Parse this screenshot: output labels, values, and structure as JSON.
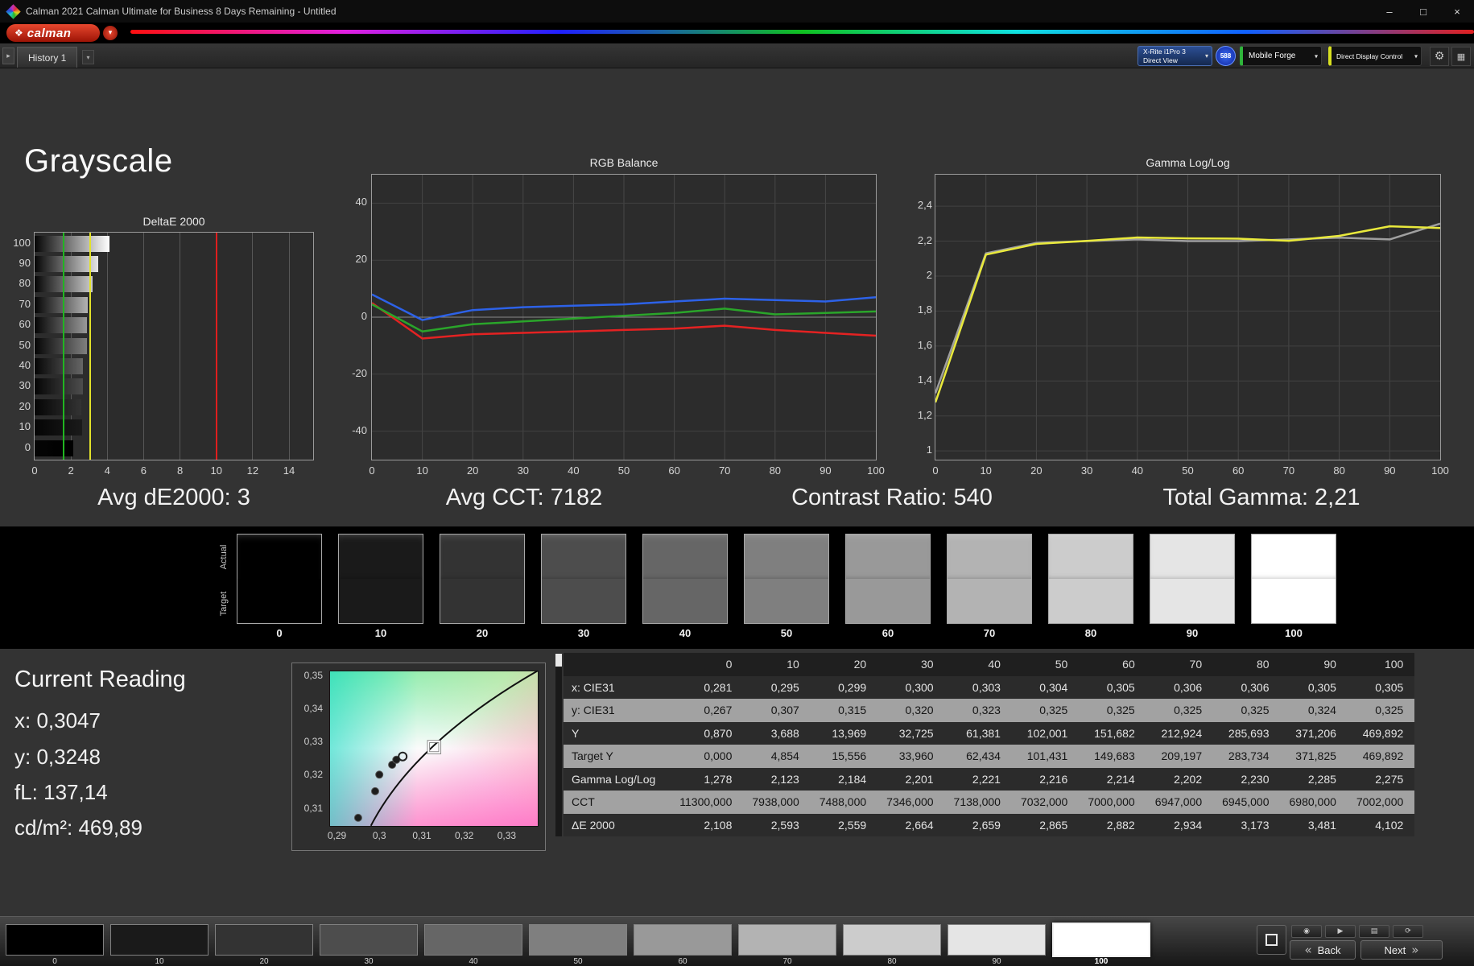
{
  "window": {
    "title": "Calman 2021 Calman Ultimate for Business 8 Days Remaining - Untitled",
    "minimize": "–",
    "maximize": "□",
    "close": "×"
  },
  "toolbar": {
    "logo_mark": "❖",
    "logo": "calman",
    "caret": "▾"
  },
  "tabbar": {
    "toggle": "▸",
    "history_tab": "History 1",
    "tab_menu": "▾",
    "xrite_line1": "X-Rite i1Pro 3",
    "xrite_line2": "Direct View",
    "meter_badge": "588",
    "mobile_forge": "Mobile Forge",
    "display_control": "Direct Display Control",
    "gear": "⚙",
    "layout": "▦"
  },
  "page": {
    "title": "Grayscale",
    "stat_de": "Avg dE2000: 3",
    "stat_cct": "Avg CCT: 7182",
    "stat_contrast": "Contrast Ratio: 540",
    "stat_gamma": "Total Gamma: 2,21"
  },
  "strip": {
    "actual_label": "Actual",
    "target_label": "Target",
    "levels": [
      0,
      10,
      20,
      30,
      40,
      50,
      60,
      70,
      80,
      90,
      100
    ]
  },
  "current_reading": {
    "title": "Current Reading",
    "x": "x: 0,3047",
    "y": "y: 0,3248",
    "fl": "fL: 137,14",
    "cd": "cd/m²: 469,89"
  },
  "table": {
    "columns": [
      "",
      "0",
      "10",
      "20",
      "30",
      "40",
      "50",
      "60",
      "70",
      "80",
      "90",
      "100"
    ],
    "rows": [
      {
        "label": "x: CIE31",
        "values": [
          "0,281",
          "0,295",
          "0,299",
          "0,300",
          "0,303",
          "0,304",
          "0,305",
          "0,306",
          "0,306",
          "0,305",
          "0,305"
        ]
      },
      {
        "label": "y: CIE31",
        "values": [
          "0,267",
          "0,307",
          "0,315",
          "0,320",
          "0,323",
          "0,325",
          "0,325",
          "0,325",
          "0,325",
          "0,324",
          "0,325"
        ]
      },
      {
        "label": "Y",
        "values": [
          "0,870",
          "3,688",
          "13,969",
          "32,725",
          "61,381",
          "102,001",
          "151,682",
          "212,924",
          "285,693",
          "371,206",
          "469,892"
        ]
      },
      {
        "label": "Target Y",
        "values": [
          "0,000",
          "4,854",
          "15,556",
          "33,960",
          "62,434",
          "101,431",
          "149,683",
          "209,197",
          "283,734",
          "371,825",
          "469,892"
        ]
      },
      {
        "label": "Gamma Log/Log",
        "values": [
          "1,278",
          "2,123",
          "2,184",
          "2,201",
          "2,221",
          "2,216",
          "2,214",
          "2,202",
          "2,230",
          "2,285",
          "2,275"
        ]
      },
      {
        "label": "CCT",
        "values": [
          "11300,000",
          "7938,000",
          "7488,000",
          "7346,000",
          "7138,000",
          "7032,000",
          "7000,000",
          "6947,000",
          "6945,000",
          "6980,000",
          "7002,000"
        ]
      },
      {
        "label": "ΔE 2000",
        "values": [
          "2,108",
          "2,593",
          "2,559",
          "2,664",
          "2,659",
          "2,865",
          "2,882",
          "2,934",
          "3,173",
          "3,481",
          "4,102"
        ]
      }
    ]
  },
  "bottom": {
    "levels": [
      0,
      10,
      20,
      30,
      40,
      50,
      60,
      70,
      80,
      90,
      100
    ],
    "selected": 100,
    "back": "Back",
    "next": "Next",
    "back_chevron": "«",
    "next_chevron": "»",
    "tool_icons": [
      "◉",
      "▶",
      "▤",
      "⟳"
    ]
  },
  "chart_data": [
    {
      "type": "bar",
      "orientation": "horizontal",
      "title": "DeltaE 2000",
      "categories": [
        "100",
        "90",
        "80",
        "70",
        "60",
        "50",
        "40",
        "30",
        "20",
        "10",
        "0"
      ],
      "values": [
        4.102,
        3.481,
        3.173,
        2.934,
        2.882,
        2.865,
        2.659,
        2.664,
        2.559,
        2.593,
        2.108
      ],
      "xlim": [
        0,
        14
      ],
      "xticks": [
        0,
        2,
        4,
        6,
        8,
        10,
        12,
        14
      ],
      "reference_lines": [
        {
          "x": 1.6,
          "color": "#21b521"
        },
        {
          "x": 3.05,
          "color": "#e2e22a"
        },
        {
          "x": 10,
          "color": "#e01e1e"
        }
      ]
    },
    {
      "type": "line",
      "title": "RGB Balance",
      "x": [
        0,
        10,
        20,
        30,
        40,
        50,
        60,
        70,
        80,
        90,
        100
      ],
      "xticks": [
        0,
        10,
        20,
        30,
        40,
        50,
        60,
        70,
        80,
        90,
        100
      ],
      "ylim": [
        -50,
        50
      ],
      "yticks": [
        40,
        20,
        0,
        -20,
        -40
      ],
      "series": [
        {
          "name": "Red",
          "color": "#e42222",
          "values": [
            5,
            -7.5,
            -6,
            -5.5,
            -5,
            -4.5,
            -4,
            -3,
            -4.5,
            -5.5,
            -6.5
          ]
        },
        {
          "name": "Green",
          "color": "#2aa52a",
          "values": [
            4.5,
            -5,
            -2.5,
            -1.5,
            -0.5,
            0.5,
            1.5,
            3,
            1,
            1.5,
            2
          ]
        },
        {
          "name": "Blue",
          "color": "#2d62e8",
          "values": [
            8,
            -1,
            2.5,
            3.5,
            4,
            4.5,
            5.5,
            6.5,
            6,
            5.5,
            7
          ]
        }
      ]
    },
    {
      "type": "line",
      "title": "Gamma Log/Log",
      "x": [
        0,
        10,
        20,
        30,
        40,
        50,
        60,
        70,
        80,
        90,
        100
      ],
      "xticks": [
        0,
        10,
        20,
        30,
        40,
        50,
        60,
        70,
        80,
        90,
        100
      ],
      "ylim": [
        0.95,
        2.58
      ],
      "yticks": [
        2.4,
        2.2,
        2,
        1.8,
        1.6,
        1.4,
        1.2,
        1
      ],
      "ytick_labels": [
        "2,4",
        "2,2",
        "2",
        "1,8",
        "1,6",
        "1,4",
        "1,2",
        "1"
      ],
      "series": [
        {
          "name": "Target Gamma",
          "color": "#9f9f9f",
          "values": [
            1.33,
            2.13,
            2.19,
            2.2,
            2.21,
            2.2,
            2.2,
            2.21,
            2.22,
            2.21,
            2.3
          ]
        },
        {
          "name": "Measured Gamma",
          "color": "#e9e93c",
          "values": [
            1.278,
            2.123,
            2.184,
            2.201,
            2.221,
            2.216,
            2.214,
            2.202,
            2.23,
            2.285,
            2.275
          ]
        }
      ]
    },
    {
      "type": "scatter",
      "title": "CIE chromaticity detail",
      "xlim": [
        0.2882,
        0.3375
      ],
      "ylim": [
        0.3043,
        0.3514
      ],
      "xticks": [
        0.29,
        0.3,
        0.31,
        0.32,
        0.33
      ],
      "xtick_labels": [
        "0,29",
        "0,3",
        "0,31",
        "0,32",
        "0,33"
      ],
      "yticks": [
        0.35,
        0.34,
        0.33,
        0.32,
        0.31
      ],
      "ytick_labels": [
        "0,35",
        "0,34",
        "0,33",
        "0,32",
        "0,31"
      ],
      "locus": [
        [
          0.298,
          0.3046
        ],
        [
          0.3083,
          0.33
        ],
        [
          0.3375,
          0.3515
        ]
      ],
      "points": [
        [
          0.295,
          0.307
        ],
        [
          0.299,
          0.315
        ],
        [
          0.3,
          0.32
        ],
        [
          0.303,
          0.323
        ],
        [
          0.304,
          0.3245
        ]
      ],
      "open_point": [
        0.3055,
        0.3255
      ],
      "target_square": [
        0.3129,
        0.3283
      ]
    }
  ]
}
